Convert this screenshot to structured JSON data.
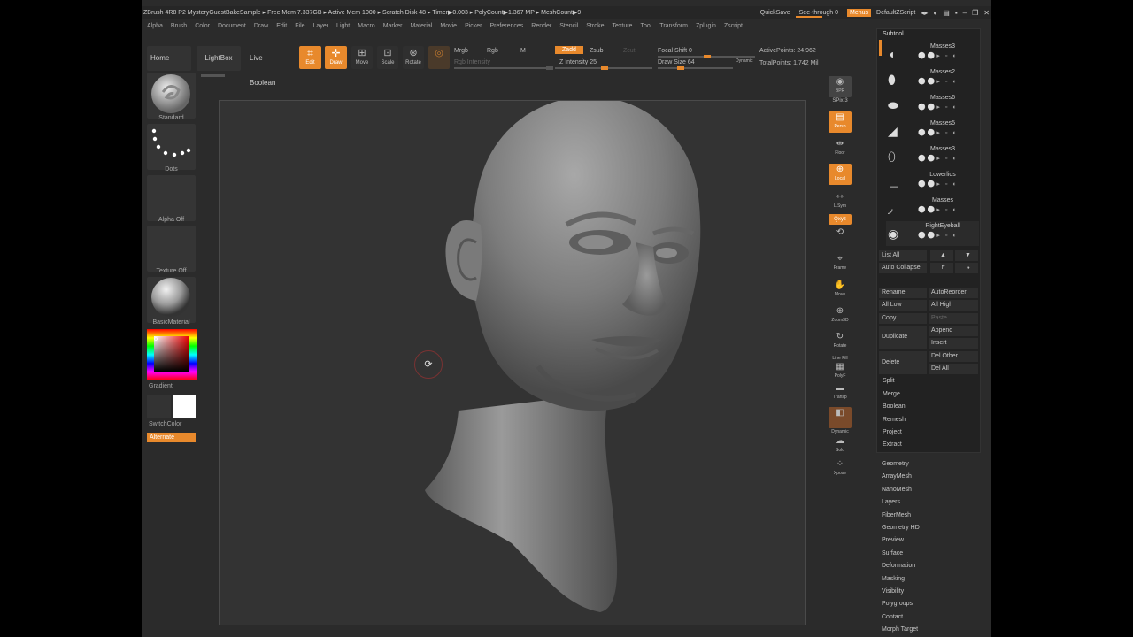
{
  "titlebar": {
    "title": "ZBrush 4R8 P2  MysteryGuestBakeSample  ▸ Free Mem 7.337GB ▸ Active Mem 1000 ▸ Scratch Disk 48 ▸ Timer▶0.003 ▸ PolyCount▶1.367 MP ▸ MeshCount▶9",
    "quicksave": "QuickSave",
    "see_through": "See-through  0",
    "menus": "Menus",
    "script": "DefaultZScript"
  },
  "menubar": [
    "Alpha",
    "Brush",
    "Color",
    "Document",
    "Draw",
    "Edit",
    "File",
    "Layer",
    "Light",
    "Macro",
    "Marker",
    "Material",
    "Movie",
    "Picker",
    "Preferences",
    "Render",
    "Stencil",
    "Stroke",
    "Texture",
    "Tool",
    "Transform",
    "Zplugin",
    "Zscript"
  ],
  "toolbar": {
    "home": "Home Page",
    "lightbox": "LightBox",
    "live_boolean": "Live Boolean",
    "edit": "Edit",
    "draw": "Draw",
    "move": "Move",
    "scale": "Scale",
    "rotate": "Rotate",
    "mrgb": "Mrgb",
    "rgb": "Rgb",
    "m": "M",
    "rgb_intensity": "Rgb Intensity",
    "zadd": "Zadd",
    "zsub": "Zsub",
    "zcut": "Zcut",
    "z_intensity": "Z Intensity 25",
    "focal_shift": "Focal Shift 0",
    "draw_size": "Draw Size 64",
    "dynamic": "Dynamic",
    "active_points": "ActivePoints: 24,962",
    "total_points": "TotalPoints: 1.742 Mil"
  },
  "leftshelf": {
    "brush": "Standard",
    "stroke": "Dots",
    "alpha": "Alpha Off",
    "texture": "Texture Off",
    "material": "BasicMaterial",
    "gradient": "Gradient",
    "switchcolor": "SwitchColor",
    "alternate": "Alternate"
  },
  "rightshelf": {
    "bpr": "BPR",
    "spix": "SPix 3",
    "persp": "Persp",
    "floor": "Floor",
    "local": "Local",
    "lsym": "L.Sym",
    "xyz": "Qxyz",
    "frame": "Frame",
    "move": "Move",
    "zoom3d": "Zoom3D",
    "rotate": "Rotate",
    "linefill": "Line Fill",
    "polyf": "PolyF",
    "transp": "Transp",
    "dynamic": "Dynamic",
    "solo": "Solo",
    "xpose": "Xpose"
  },
  "subtool": {
    "title": "Subtool",
    "items": [
      {
        "name": "Masses3"
      },
      {
        "name": "Masses2"
      },
      {
        "name": "Masses6"
      },
      {
        "name": "Masses5"
      },
      {
        "name": "Masses3"
      },
      {
        "name": "Lowerlids"
      },
      {
        "name": "Masses"
      },
      {
        "name": "RightEyeball"
      }
    ],
    "list_all": "List All",
    "auto_collapse": "Auto Collapse",
    "rename": "Rename",
    "autoreorder": "AutoReorder",
    "all_low": "All Low",
    "all_high": "All High",
    "copy": "Copy",
    "paste": "Paste",
    "duplicate": "Duplicate",
    "append": "Append",
    "insert": "Insert",
    "delete": "Delete",
    "del_other": "Del Other",
    "del_all": "Del All",
    "split": "Split",
    "merge": "Merge",
    "boolean": "Boolean",
    "remesh": "Remesh",
    "project": "Project",
    "extract": "Extract"
  },
  "toolmenu": [
    "Geometry",
    "ArrayMesh",
    "NanoMesh",
    "Layers",
    "FiberMesh",
    "Geometry HD",
    "Preview",
    "Surface",
    "Deformation",
    "Masking",
    "Visibility",
    "Polygroups",
    "Contact",
    "Morph Target"
  ],
  "colors": {
    "accent": "#e8892c",
    "background": "#2b2b2b",
    "canvas": "#333333"
  }
}
